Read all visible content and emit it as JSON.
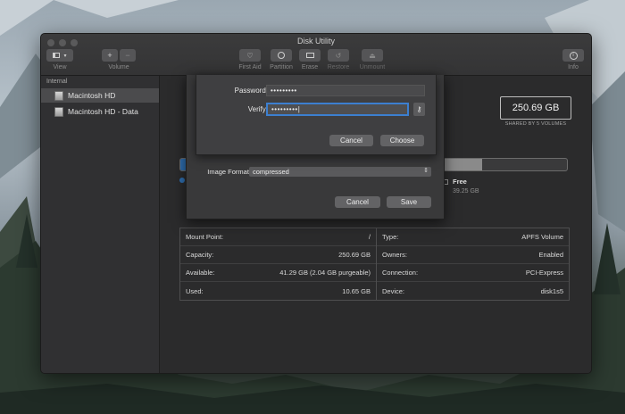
{
  "window": {
    "title": "Disk Utility"
  },
  "toolbar": {
    "view_label": "View",
    "volume_label": "Volume",
    "add_glyph": "+",
    "remove_glyph": "−",
    "first_aid_label": "First Aid",
    "partition_label": "Partition",
    "erase_label": "Erase",
    "restore_label": "Restore",
    "unmount_label": "Unmount",
    "info_label": "Info"
  },
  "sidebar": {
    "section_label": "Internal",
    "items": [
      {
        "label": "Macintosh HD",
        "selected": true
      },
      {
        "label": "Macintosh HD - Data",
        "selected": false
      }
    ]
  },
  "volume": {
    "capacity_display": "250.69 GB",
    "shared_label": "SHARED BY 5 VOLUMES",
    "used_fraction": 0.04,
    "purgeable_fraction": 0.78,
    "free_label": "Free",
    "free_value": "39.25 GB",
    "accent_color": "#2f6fb0"
  },
  "info_left": [
    {
      "label": "Mount Point:",
      "value": "/"
    },
    {
      "label": "Capacity:",
      "value": "250.69 GB"
    },
    {
      "label": "Available:",
      "value": "41.29 GB (2.04 GB purgeable)"
    },
    {
      "label": "Used:",
      "value": "10.65 GB"
    }
  ],
  "info_right": [
    {
      "label": "Type:",
      "value": "APFS Volume"
    },
    {
      "label": "Owners:",
      "value": "Enabled"
    },
    {
      "label": "Connection:",
      "value": "PCI-Express"
    },
    {
      "label": "Device:",
      "value": "disk1s5"
    }
  ],
  "save_sheet": {
    "image_format_label": "Image Format:",
    "image_format_value": "compressed",
    "cancel_label": "Cancel",
    "save_label": "Save"
  },
  "password_sheet": {
    "password_label": "Password:",
    "password_value": "•••••••••",
    "verify_label": "Verify:",
    "verify_value": "•••••••••|",
    "cancel_label": "Cancel",
    "choose_label": "Choose"
  }
}
